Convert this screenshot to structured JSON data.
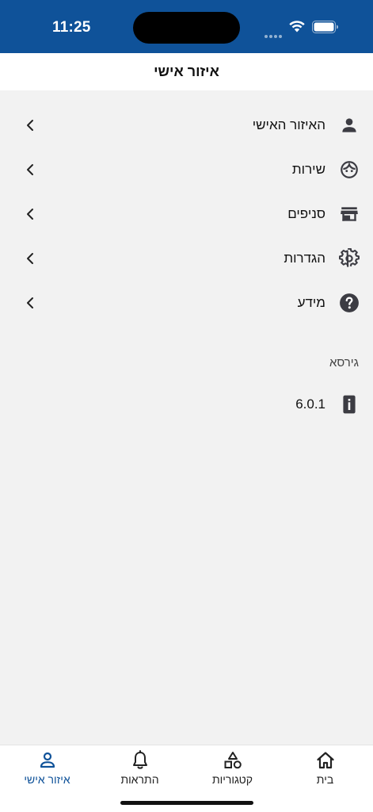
{
  "status_bar": {
    "time": "11:25",
    "icons": [
      "signal-icon",
      "wifi-icon",
      "battery-icon"
    ]
  },
  "header": {
    "title": "איזור אישי"
  },
  "menu": {
    "items": [
      {
        "label": "האיזור האישי",
        "icon": "person-icon"
      },
      {
        "label": "שירות",
        "icon": "support-agent-icon"
      },
      {
        "label": "סניפים",
        "icon": "store-icon"
      },
      {
        "label": "הגדרות",
        "icon": "gear-icon"
      },
      {
        "label": "מידע",
        "icon": "help-icon"
      }
    ]
  },
  "version_section": {
    "label": "גירסא",
    "value": "6.0.1",
    "icon": "info-device-icon"
  },
  "tabbar": {
    "tabs": [
      {
        "label": "איזור אישי",
        "icon": "person-outline-icon",
        "active": true
      },
      {
        "label": "התראות",
        "icon": "bell-icon",
        "active": false
      },
      {
        "label": "קטגוריות",
        "icon": "categories-icon",
        "active": false
      },
      {
        "label": "בית",
        "icon": "home-icon",
        "active": false
      }
    ]
  },
  "colors": {
    "brand": "#0f5299",
    "background": "#f2f2f2",
    "icon": "#3c3c43"
  }
}
